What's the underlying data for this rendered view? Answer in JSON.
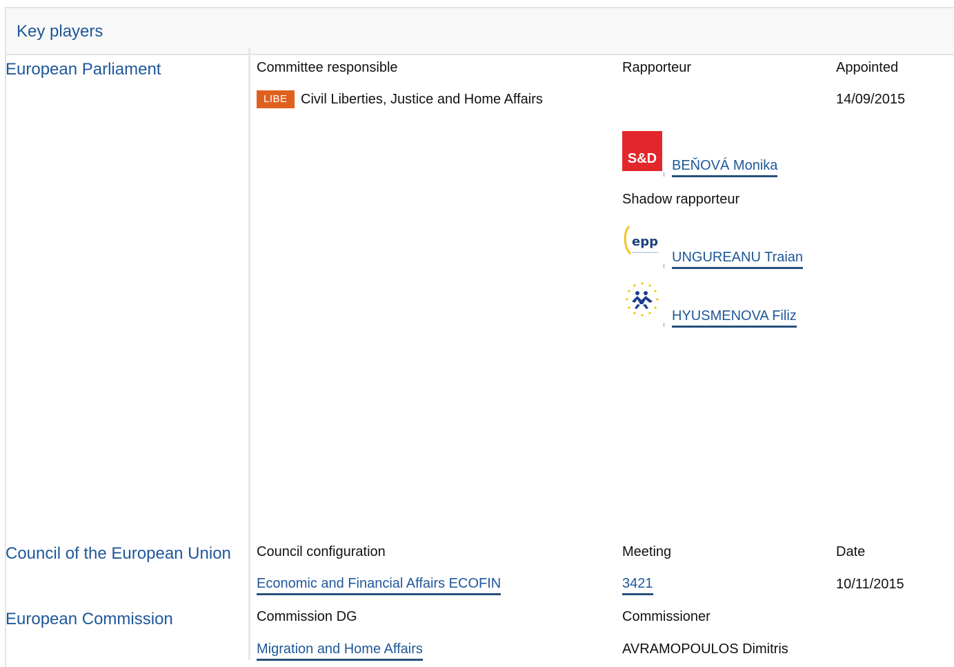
{
  "header": {
    "title": "Key players"
  },
  "parliament": {
    "section_title": "European Parliament",
    "col_committee": "Committee responsible",
    "col_rapporteur": "Rapporteur",
    "col_appointed": "Appointed",
    "committee_badge": "LIBE",
    "committee_name": "Civil Liberties, Justice and Home Affairs",
    "appointed_date": "14/09/2015",
    "rapporteur": {
      "group_logo": "S&D",
      "name": "BEŇOVÁ Monika"
    },
    "shadow_label": "Shadow rapporteur",
    "shadow_rapporteurs": [
      {
        "group_logo": "epp",
        "name": "UNGUREANU Traian"
      },
      {
        "group_logo": "alde-stars",
        "name": "HYUSMENOVA Filiz"
      }
    ]
  },
  "council": {
    "section_title": "Council of the European Union",
    "col_configuration": "Council configuration",
    "col_meeting": "Meeting",
    "col_date": "Date",
    "configuration": "Economic and Financial Affairs ECOFIN",
    "meeting": "3421",
    "date": "10/11/2015"
  },
  "commission": {
    "section_title": "European Commission",
    "col_dg": "Commission DG",
    "col_commissioner": "Commissioner",
    "dg": "Migration and Home Affairs",
    "commissioner": "AVRAMOPOULOS Dimitris"
  },
  "colors": {
    "accent": "#1e5799",
    "badge": "#e0611f",
    "sd_logo": "#e3262b"
  }
}
